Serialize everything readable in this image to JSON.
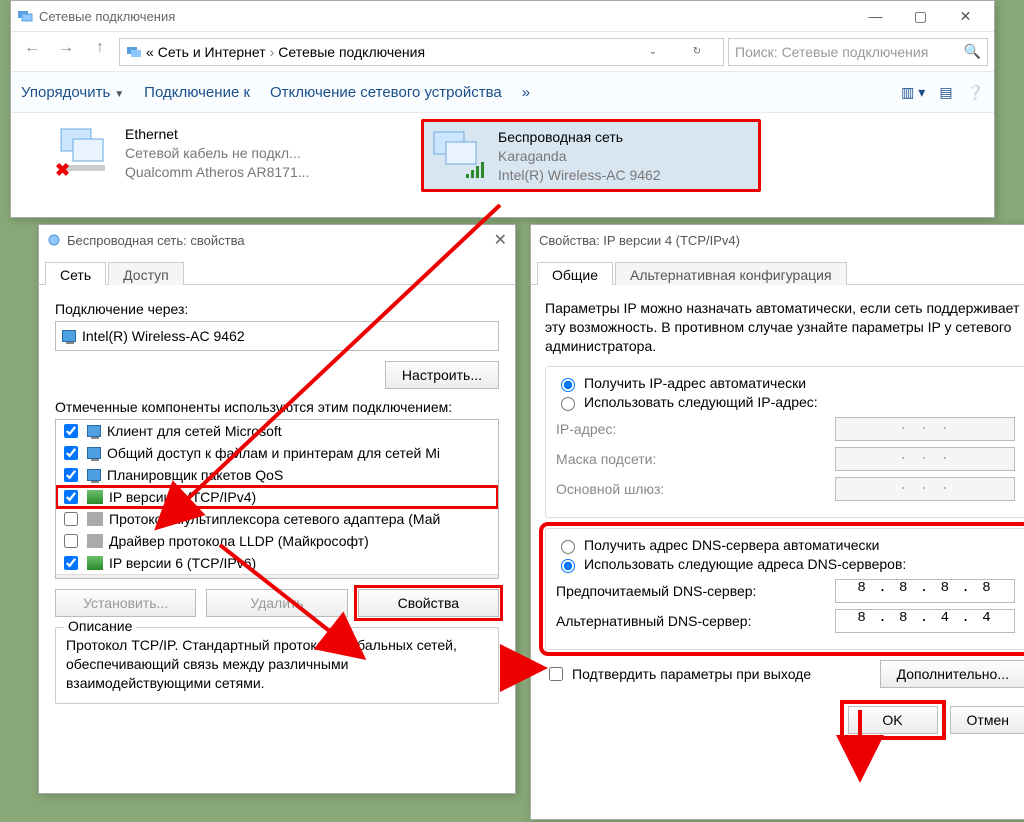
{
  "explorer": {
    "title": "Сетевые подключения",
    "breadcrumb_prefix": "«",
    "breadcrumb1": "Сеть и Интернет",
    "breadcrumb2": "Сетевые подключения",
    "search_placeholder": "Поиск: Сетевые подключения",
    "toolbar": {
      "organize": "Упорядочить",
      "connect": "Подключение к",
      "disable": "Отключение сетевого устройства",
      "more": "»"
    },
    "items": [
      {
        "name": "Ethernet",
        "status": "Сетевой кабель не подкл...",
        "device": "Qualcomm Atheros AR8171..."
      },
      {
        "name": "Беспроводная сеть",
        "status": "Karaganda",
        "device": "Intel(R) Wireless-AC 9462"
      }
    ]
  },
  "props": {
    "title": "Беспроводная сеть: свойства",
    "tabs": {
      "net": "Сеть",
      "access": "Доступ"
    },
    "connect_via": "Подключение через:",
    "adapter": "Intel(R) Wireless-AC 9462",
    "configure": "Настроить...",
    "components_label": "Отмеченные компоненты используются этим подключением:",
    "components": [
      {
        "checked": true,
        "icon": "mon",
        "label": "Клиент для сетей Microsoft"
      },
      {
        "checked": true,
        "icon": "mon",
        "label": "Общий доступ к файлам и принтерам для сетей Mi"
      },
      {
        "checked": true,
        "icon": "mon",
        "label": "Планировщик пакетов QoS"
      },
      {
        "checked": true,
        "icon": "net",
        "label": "IP версии 4 (TCP/IPv4)",
        "highlight": true
      },
      {
        "checked": false,
        "icon": "net",
        "label": "Протокол мультиплексора сетевого адаптера (Май"
      },
      {
        "checked": false,
        "icon": "net",
        "label": "Драйвер протокола LLDP (Майкрософт)"
      },
      {
        "checked": true,
        "icon": "net",
        "label": "IP версии 6 (TCP/IPv6)"
      }
    ],
    "btn_install": "Установить...",
    "btn_remove": "Удалить",
    "btn_props": "Свойства",
    "desc_title": "Описание",
    "desc_text": "Протокол TCP/IP. Стандартный протокол глобальных сетей, обеспечивающий связь между различными взаимодействующими сетями."
  },
  "ipv4": {
    "title": "Свойства: IP версии 4 (TCP/IPv4)",
    "tabs": {
      "general": "Общие",
      "alt": "Альтернативная конфигурация"
    },
    "desc": "Параметры IP можно назначать автоматически, если сеть поддерживает эту возможность. В противном случае узнайте параметры IP у сетевого администратора.",
    "ip_auto": "Получить IP-адрес автоматически",
    "ip_manual": "Использовать следующий IP-адрес:",
    "ip_addr_label": "IP-адрес:",
    "mask_label": "Маска подсети:",
    "gw_label": "Основной шлюз:",
    "dns_auto": "Получить адрес DNS-сервера автоматически",
    "dns_manual": "Использовать следующие адреса DNS-серверов:",
    "dns1_label": "Предпочитаемый DNS-сервер:",
    "dns2_label": "Альтернативный DNS-сервер:",
    "dns1": "8 . 8 . 8 . 8",
    "dns2": "8 . 8 . 4 . 4",
    "validate": "Подтвердить параметры при выходе",
    "advanced": "Дополнительно...",
    "ok": "OK",
    "cancel": "Отмен"
  },
  "dots": ".   .   ."
}
